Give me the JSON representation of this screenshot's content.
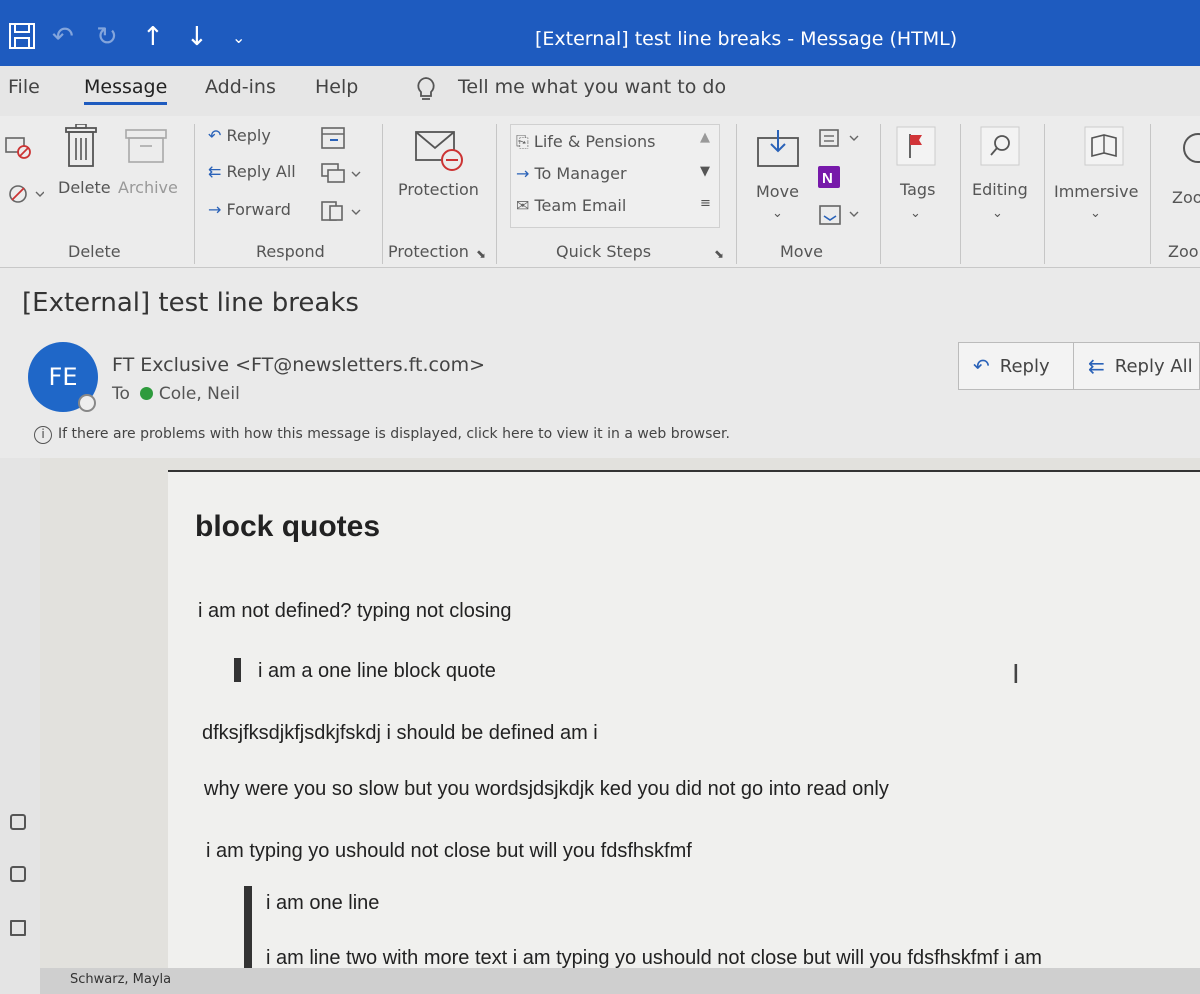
{
  "window": {
    "title": "[External] test line breaks  -  Message (HTML)"
  },
  "menu": {
    "file": "File",
    "message": "Message",
    "addins": "Add-ins",
    "help": "Help",
    "tell_me": "Tell me what you want to do"
  },
  "ribbon": {
    "delete_group": {
      "delete": "Delete",
      "archive": "Archive",
      "label": "Delete"
    },
    "respond_group": {
      "reply": "Reply",
      "reply_all": "Reply All",
      "forward": "Forward",
      "label": "Respond"
    },
    "protection_group": {
      "button": "Protection",
      "label": "Protection"
    },
    "quick_steps_group": {
      "items": [
        "Life & Pensions",
        "To Manager",
        "Team Email"
      ],
      "label": "Quick Steps"
    },
    "move_group": {
      "button": "Move",
      "label": "Move"
    },
    "tags": "Tags",
    "editing": "Editing",
    "immersive": "Immersive",
    "zoom": "Zoo",
    "zoom_group_label": "Zoo"
  },
  "message": {
    "subject": "[External] test line breaks",
    "avatar_initials": "FE",
    "sender": "FT Exclusive <FT@newsletters.ft.com>",
    "to_label": "To",
    "to_name": "Cole, Neil",
    "info": "If there are problems with how this message is displayed, click here to view it in a web browser.",
    "reply": "Reply",
    "reply_all": "Reply All"
  },
  "body": {
    "heading": "block quotes",
    "line1": "i am not defined? typing not closing",
    "quote1": "i am a one line block quote",
    "line2": "dfksjfksdjkfjsdkjfskdj i should be defined am i",
    "line3": "why were you so slow but you wordsjdsjkdjk ked you did not go into read only",
    "line4": "i am typing yo ushould not close but will you fdsfhskfmf",
    "quote2_line1": "i am one line",
    "quote2_line2": "i am line two with more text i am typing yo ushould not close but will you fdsfhskfmf i am"
  },
  "footer": {
    "left": "Schwarz, Mayla"
  },
  "colors": {
    "titlebar": "#1e5bbf",
    "avatar": "#1f67c8",
    "presence_green": "#2e9b3d",
    "flag_red": "#d13438",
    "onenote_purple": "#7719aa"
  }
}
